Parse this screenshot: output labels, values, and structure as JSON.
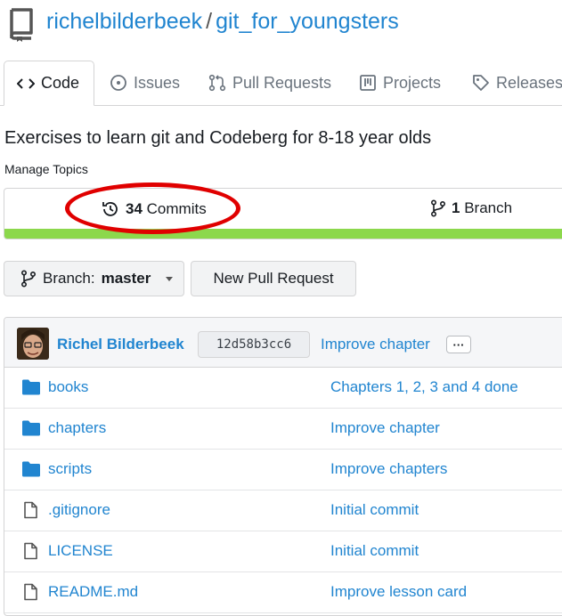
{
  "header": {
    "owner": "richelbilderbeek",
    "separator": "/",
    "repo": "git_for_youngsters",
    "icon": "repo-icon"
  },
  "tabs": [
    {
      "label": "Code",
      "icon": "code-icon",
      "active": true
    },
    {
      "label": "Issues",
      "icon": "issues-icon"
    },
    {
      "label": "Pull Requests",
      "icon": "pull-request-icon"
    },
    {
      "label": "Projects",
      "icon": "projects-icon"
    },
    {
      "label": "Releases",
      "icon": "tag-icon"
    }
  ],
  "description": "Exercises to learn git and Codeberg for 8-18 year olds",
  "manage_topics": "Manage Topics",
  "stats": {
    "commits_count": "34",
    "commits_label": "Commits",
    "branch_count": "1",
    "branch_label": "Branch",
    "language_bar_color": "#8cd84c",
    "highlight_color": "#e00000"
  },
  "branch_button": {
    "prefix": "Branch:",
    "value": "master"
  },
  "new_pr_button": "New Pull Request",
  "latest_commit": {
    "author": "Richel Bilderbeek",
    "sha": "12d58b3cc6",
    "message": "Improve chapter",
    "more": "···"
  },
  "files": [
    {
      "name": "books",
      "type": "folder",
      "message": "Chapters 1, 2, 3 and 4 done"
    },
    {
      "name": "chapters",
      "type": "folder",
      "message": "Improve chapter"
    },
    {
      "name": "scripts",
      "type": "folder",
      "message": "Improve chapters"
    },
    {
      "name": ".gitignore",
      "type": "file",
      "message": "Initial commit"
    },
    {
      "name": "LICENSE",
      "type": "file",
      "message": "Initial commit"
    },
    {
      "name": "README.md",
      "type": "file",
      "message": "Improve lesson card"
    }
  ]
}
